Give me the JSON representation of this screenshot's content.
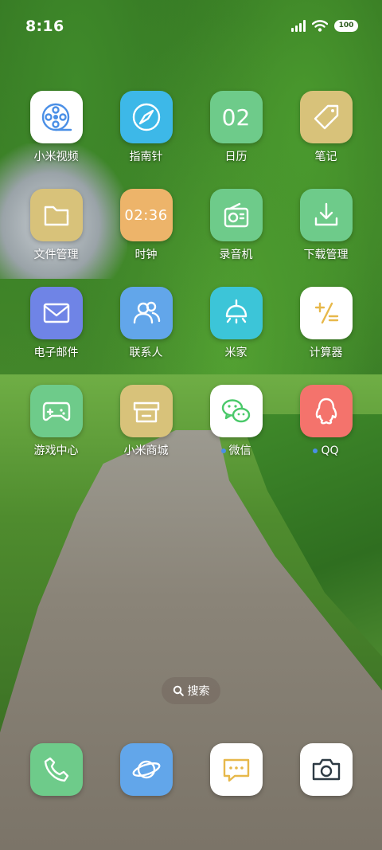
{
  "status_bar": {
    "time": "8:16",
    "battery": "100"
  },
  "apps": [
    {
      "id": "mi-video",
      "label": "小米视频",
      "icon": "film-reel-icon",
      "bg": "#ffffff",
      "fg": "#4a8fe6",
      "dot": false
    },
    {
      "id": "compass",
      "label": "指南针",
      "icon": "compass-icon",
      "bg": "#3db8e8",
      "fg": "#ffffff",
      "dot": false
    },
    {
      "id": "calendar",
      "label": "日历",
      "icon": "calendar-date-icon",
      "icon_text": "02",
      "bg": "#6ecb8a",
      "fg": "#ffffff",
      "dot": false
    },
    {
      "id": "notes",
      "label": "笔记",
      "icon": "tag-icon",
      "bg": "#d8c27a",
      "fg": "#ffffff",
      "dot": false
    },
    {
      "id": "file-manager",
      "label": "文件管理",
      "icon": "folder-icon",
      "bg": "#d8c27a",
      "fg": "#ffffff",
      "dot": false
    },
    {
      "id": "clock",
      "label": "时钟",
      "icon": "digital-clock-icon",
      "icon_text": "02:36",
      "bg": "#edb46a",
      "fg": "#ffffff",
      "dot": false
    },
    {
      "id": "recorder",
      "label": "录音机",
      "icon": "radio-recorder-icon",
      "bg": "#6ecb8a",
      "fg": "#ffffff",
      "dot": false
    },
    {
      "id": "downloads",
      "label": "下载管理",
      "icon": "download-icon",
      "bg": "#6ecb8a",
      "fg": "#ffffff",
      "dot": false
    },
    {
      "id": "email",
      "label": "电子邮件",
      "icon": "envelope-icon",
      "bg": "#6f84e6",
      "fg": "#ffffff",
      "dot": false
    },
    {
      "id": "contacts",
      "label": "联系人",
      "icon": "contacts-people-icon",
      "bg": "#62a6ea",
      "fg": "#ffffff",
      "dot": false
    },
    {
      "id": "mi-home",
      "label": "米家",
      "icon": "ceiling-lamp-icon",
      "bg": "#3cc5d8",
      "fg": "#ffffff",
      "dot": false
    },
    {
      "id": "calculator",
      "label": "计算器",
      "icon": "calculator-icon",
      "bg": "#ffffff",
      "fg": "#e7b84a",
      "dot": false
    },
    {
      "id": "game-center",
      "label": "游戏中心",
      "icon": "gamepad-icon",
      "bg": "#6ecb8a",
      "fg": "#ffffff",
      "dot": false
    },
    {
      "id": "mi-store",
      "label": "小米商城",
      "icon": "storefront-icon",
      "bg": "#d8c27a",
      "fg": "#ffffff",
      "dot": false
    },
    {
      "id": "wechat",
      "label": "微信",
      "icon": "wechat-icon",
      "bg": "#ffffff",
      "fg": "#4ac96a",
      "dot": true
    },
    {
      "id": "qq",
      "label": "QQ",
      "icon": "qq-penguin-icon",
      "bg": "#f4736c",
      "fg": "#ffffff",
      "dot": true
    }
  ],
  "search": {
    "label": "搜索"
  },
  "dock": [
    {
      "id": "phone",
      "icon": "phone-icon",
      "bg": "#6ecb8a",
      "fg": "#ffffff"
    },
    {
      "id": "browser",
      "icon": "planet-browser-icon",
      "bg": "#62a6ea",
      "fg": "#ffffff"
    },
    {
      "id": "messages",
      "icon": "message-bubble-icon",
      "bg": "#ffffff",
      "fg": "#e7b84a"
    },
    {
      "id": "camera",
      "icon": "camera-icon",
      "bg": "#ffffff",
      "fg": "#2d3a44"
    }
  ]
}
